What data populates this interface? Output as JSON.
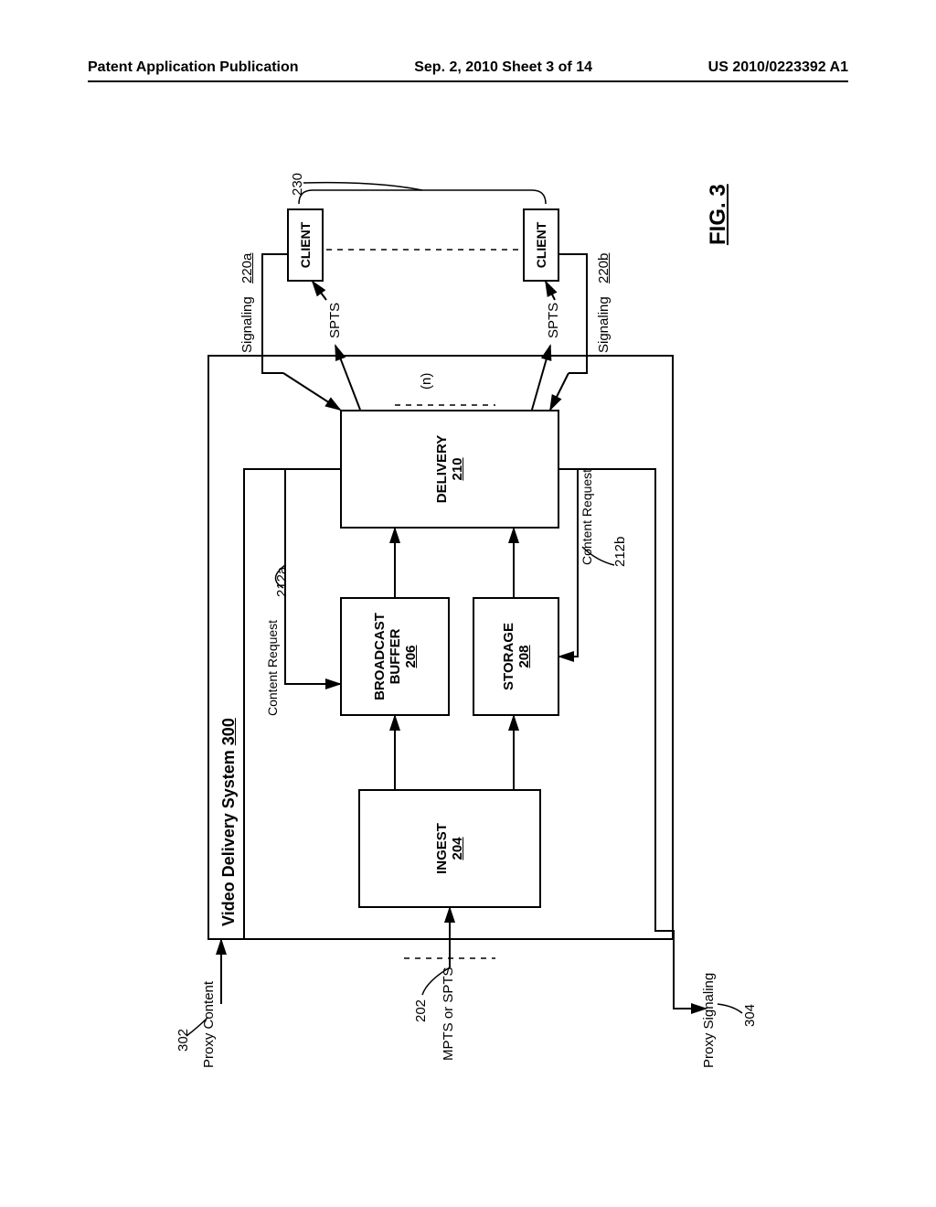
{
  "header": {
    "left": "Patent Application Publication",
    "center": "Sep. 2, 2010  Sheet 3 of 14",
    "right": "US 2010/0223392 A1"
  },
  "figure": {
    "label": "FIG. 3",
    "system_title": "Video Delivery System",
    "system_num": "300"
  },
  "blocks": {
    "ingest": {
      "label": "INGEST",
      "num": "204"
    },
    "broadcast_buffer": {
      "label1": "BROADCAST",
      "label2": "BUFFER",
      "num": "206"
    },
    "storage": {
      "label": "STORAGE",
      "num": "208"
    },
    "delivery": {
      "label": "DELIVERY",
      "num": "210"
    },
    "client_top": {
      "label": "CLIENT"
    },
    "client_bottom": {
      "label": "CLIENT"
    },
    "clients_ref": "230"
  },
  "signals": {
    "proxy_content": {
      "label": "Proxy Content",
      "ref": "302"
    },
    "mpts_spts": {
      "label": "MPTS or SPTS",
      "ref": "202"
    },
    "proxy_signaling": {
      "label": "Proxy Signaling",
      "ref": "304"
    },
    "content_request_a": {
      "label": "Content Request",
      "ref": "212a"
    },
    "content_request_b": {
      "label": "Content Request",
      "ref": "212b"
    },
    "signaling_a": {
      "label": "Signaling",
      "ref": "220a"
    },
    "signaling_b": {
      "label": "Signaling",
      "ref": "220b"
    },
    "spts_a": "SPTS",
    "spts_b": "SPTS",
    "n": "(n)"
  }
}
